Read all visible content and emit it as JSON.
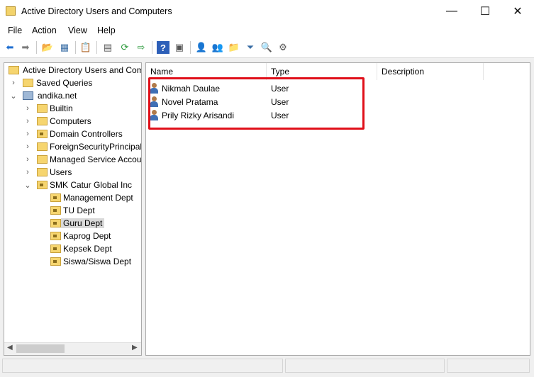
{
  "window": {
    "title": "Active Directory Users and Computers",
    "minimize": "—",
    "maximize": "☐",
    "close": "✕"
  },
  "menu": [
    "File",
    "Action",
    "View",
    "Help"
  ],
  "toolbar_icons": [
    "back-arrow",
    "forward-arrow",
    "up-folder",
    "show-hide-tree",
    "copy",
    "properties",
    "refresh",
    "export-list",
    "help",
    "console-view",
    "new-user",
    "new-group",
    "new-ou",
    "filter",
    "find",
    "delegate"
  ],
  "tree": {
    "root": "Active Directory Users and Com",
    "saved_queries": "Saved Queries",
    "domain": "andika.net",
    "children": [
      "Builtin",
      "Computers",
      "Domain Controllers",
      "ForeignSecurityPrincipals",
      "Managed Service Accour",
      "Users"
    ],
    "ou": "SMK Catur Global Inc",
    "ou_children": [
      "Management Dept",
      "TU Dept",
      "Guru Dept",
      "Kaprog Dept",
      "Kepsek Dept",
      "Siswa/Siswa Dept"
    ],
    "selected": "Guru Dept"
  },
  "list": {
    "columns": [
      "Name",
      "Type",
      "Description"
    ],
    "rows": [
      {
        "name": "Nikmah Daulae",
        "type": "User",
        "description": ""
      },
      {
        "name": "Novel Pratama",
        "type": "User",
        "description": ""
      },
      {
        "name": "Prily Rizky Arisandi",
        "type": "User",
        "description": ""
      }
    ]
  },
  "colors": {
    "highlight": "#e0101a",
    "selection": "#d9d9d9"
  }
}
